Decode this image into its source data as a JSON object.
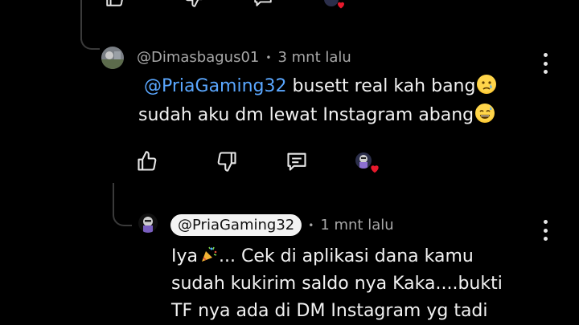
{
  "comments": [
    {
      "username": "@Dimasbagus01",
      "time": "3 mnt lalu",
      "mention": "@PriaGaming32",
      "line1_rest": " busett real kah bang",
      "line2": "sudah aku dm lewat Instagram abang",
      "emoji1": "crying-face-emoji",
      "emoji2": "sweat-smile-emoji"
    },
    {
      "username": "@PriaGaming32",
      "time": "1 mnt lalu",
      "line1_a": "Iya",
      "line1_b": "... Cek di aplikasi dana kamu",
      "line2": "sudah kukirim saldo nya Kaka....bukti",
      "line3": "TF nya ada di DM Instagram yg tadi",
      "emoji1": "party-popper-emoji"
    }
  ],
  "actions": {
    "like_icon": "thumbs-up-icon",
    "dislike_icon": "thumbs-down-icon",
    "reply_icon": "comment-icon",
    "creator_heart_icon": "heart-icon"
  },
  "colors": {
    "background": "#000000",
    "mention": "#5aa7ff",
    "heart": "#e8192c"
  }
}
